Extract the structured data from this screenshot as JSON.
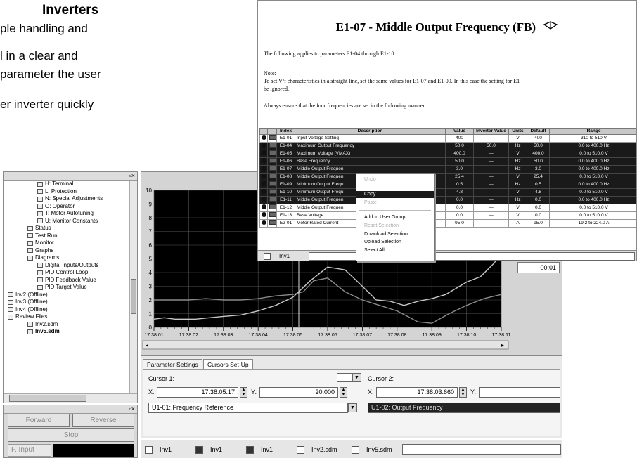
{
  "heading": {
    "title": "Inverters",
    "lines": [
      "ple handling and",
      "l in a clear and",
      "parameter the user",
      "er inverter quickly"
    ]
  },
  "tree": {
    "items": [
      {
        "label": "H: Terminal",
        "indent": 3
      },
      {
        "label": "L: Protection",
        "indent": 3
      },
      {
        "label": "N: Special Adjustments",
        "indent": 3
      },
      {
        "label": "O: Operator",
        "indent": 3
      },
      {
        "label": "T: Motor Autotuning",
        "indent": 3
      },
      {
        "label": "U: Monitor Constants",
        "indent": 3
      },
      {
        "label": "Status",
        "indent": 2
      },
      {
        "label": "Test Run",
        "indent": 2
      },
      {
        "label": "Monitor",
        "indent": 2
      },
      {
        "label": "Graphs",
        "indent": 2
      },
      {
        "label": "Diagrams",
        "indent": 2
      },
      {
        "label": "Digital Inputs/Outputs",
        "indent": 3
      },
      {
        "label": "PID Control Loop",
        "indent": 3
      },
      {
        "label": "PID Feedback Value",
        "indent": 3
      },
      {
        "label": "PID Target Value",
        "indent": 3
      },
      {
        "label": "Inv2 (Offline)",
        "indent": 0
      },
      {
        "label": "Inv3 (Offline)",
        "indent": 0
      },
      {
        "label": "Inv4 (Offline)",
        "indent": 0
      },
      {
        "label": "Review Files",
        "indent": 0
      },
      {
        "label": "Inv2.sdm",
        "indent": 2
      },
      {
        "label": "Inv5.sdm",
        "indent": 2
      }
    ]
  },
  "operator": {
    "forward": "Forward",
    "reverse": "Reverse",
    "stop": "Stop",
    "f_input": "F. Input"
  },
  "chart_data": {
    "type": "line",
    "y_ticks": [
      "0",
      "1",
      "2",
      "3",
      "4",
      "5",
      "6",
      "7",
      "8",
      "9",
      "10"
    ],
    "ylim": [
      0,
      10
    ],
    "x_ticks": [
      "17:38:01",
      "17:38:02",
      "17:38:03",
      "17:38:04",
      "17:38:05",
      "17:38:06",
      "17:38:07",
      "17:38:08",
      "17:38:09",
      "17:38:10",
      "17:38:11"
    ],
    "grid": true,
    "series": [
      {
        "x": [
          0,
          0.3,
          0.6,
          0.9,
          1.2,
          1.6,
          2.0,
          2.5,
          3.0,
          3.5,
          4.0,
          4.5,
          5.0,
          5.5,
          6.0,
          6.4,
          6.8,
          7.2,
          7.6,
          8.0,
          8.4,
          8.8,
          9.0,
          9.4,
          9.8,
          10.0
        ],
        "values": [
          0.6,
          0.7,
          0.6,
          0.6,
          0.6,
          0.7,
          0.8,
          0.9,
          1.2,
          1.6,
          2.2,
          3.4,
          4.4,
          4.2,
          3.0,
          2.0,
          1.9,
          1.6,
          1.9,
          2.1,
          2.4,
          3.0,
          3.3,
          3.7,
          4.7,
          5.5
        ]
      },
      {
        "x": [
          0,
          0.5,
          1.0,
          1.5,
          2.0,
          2.5,
          3.0,
          3.5,
          4.0,
          4.3,
          4.6,
          5.0,
          5.5,
          6.0,
          6.5,
          7.0,
          7.3,
          7.6,
          8.0,
          8.5,
          9.0,
          9.5,
          10.0
        ],
        "values": [
          2.0,
          2.0,
          2.0,
          2.1,
          2.0,
          2.0,
          2.1,
          2.3,
          2.4,
          2.6,
          3.4,
          3.6,
          2.6,
          2.0,
          1.6,
          1.2,
          0.8,
          0.4,
          0.3,
          1.0,
          1.6,
          2.1,
          2.4
        ]
      }
    ],
    "cursor_time": "17:38:05.17",
    "readout": "00:01"
  },
  "settings": {
    "tabs": [
      "Parameter Settings",
      "Cursors Set-Up"
    ],
    "cursor1_label": "Cursor 1:",
    "cursor2_label": "Cursor 2:",
    "x_label": "X:",
    "y_label": "Y:",
    "cursor1_x": "17:38:05.17",
    "cursor1_y": "20.000",
    "cursor2_x": "17:38:03.660",
    "cursor2_y": "",
    "cursor1_select": "U1-01: Frequency Reference",
    "cursor2_select": "U1-02: Output Frequency"
  },
  "statusbar": {
    "tabs": [
      "Inv1",
      "Inv1",
      "Inv1",
      "Inv2.sdm",
      "Inv5.sdm"
    ]
  },
  "help": {
    "title": "E1-07 - Middle Output Frequency (FB)",
    "p1": "The following applies to parameters E1-04 through E1-10.",
    "note": "Note:",
    "p2": "To set V/f characteristics in a straight line, set the same values for E1-07 and E1-09. In this case the setting for E1",
    "p2b": "be ignored.",
    "p3": "Always ensure that the four frequencies are set in the following manner:",
    "columns": [
      "Index",
      "Description",
      "Value",
      "Inverter Value",
      "Units",
      "Default",
      "Range"
    ],
    "rows": [
      {
        "index": "E1-01",
        "desc": "Input Voltage Setting",
        "value": "400",
        "inv": "—",
        "units": "V",
        "default": "400",
        "range": "310 to 510 V",
        "sel": false
      },
      {
        "index": "E1-04",
        "desc": "Maximum Output Frequency",
        "value": "50.0",
        "inv": "50.0",
        "units": "Hz",
        "default": "50.0",
        "range": "0.0 to 400.0 Hz",
        "sel": true
      },
      {
        "index": "E1-05",
        "desc": "Maximum Voltage (VMAX)",
        "value": "400.0",
        "inv": "—",
        "units": "V",
        "default": "400.0",
        "range": "0.0 to 510.0 V",
        "sel": true
      },
      {
        "index": "E1-06",
        "desc": "Base Frequency",
        "value": "50.0",
        "inv": "—",
        "units": "Hz",
        "default": "50.0",
        "range": "0.0 to 400.0 Hz",
        "sel": true
      },
      {
        "index": "E1-07",
        "desc": "Middle Output Frequen",
        "value": "3.0",
        "inv": "—",
        "units": "Hz",
        "default": "3.0",
        "range": "0.0 to 400.0 Hz",
        "sel": true
      },
      {
        "index": "E1-08",
        "desc": "Middle Output Frequen",
        "value": "25.4",
        "inv": "—",
        "units": "V",
        "default": "25.4",
        "range": "0.0 to 510.0 V",
        "sel": true
      },
      {
        "index": "E1-09",
        "desc": "Minimum Output Frequ",
        "value": "0.5",
        "inv": "—",
        "units": "Hz",
        "default": "0.5",
        "range": "0.0 to 400.0 Hz",
        "sel": true
      },
      {
        "index": "E1-10",
        "desc": "Minimum Output Frequ",
        "value": "4.8",
        "inv": "—",
        "units": "V",
        "default": "4.8",
        "range": "0.0 to 510.0 V",
        "sel": true
      },
      {
        "index": "E1-11",
        "desc": "Middle Output Frequen",
        "value": "0.0",
        "inv": "—",
        "units": "Hz",
        "default": "0.0",
        "range": "0.0 to 400.0 Hz",
        "sel": true
      },
      {
        "index": "E1-12",
        "desc": "Middle Output Frequen",
        "value": "0.0",
        "inv": "—",
        "units": "V",
        "default": "0.0",
        "range": "0.0 to 510.0 V",
        "sel": false
      },
      {
        "index": "E1-13",
        "desc": "Base Voltage",
        "value": "0.0",
        "inv": "—",
        "units": "V",
        "default": "0.0",
        "range": "0.0 to 510.0 V",
        "sel": false
      },
      {
        "index": "E2-01",
        "desc": "Motor Rated Current",
        "value": "95.0",
        "inv": "—",
        "units": "A",
        "default": "95.0",
        "range": "19.2 to 224.0 A",
        "sel": false
      }
    ],
    "bottom_tab": "Inv1"
  },
  "context_menu": {
    "items": [
      "Undo",
      "Copy",
      "Paste",
      "Add to User Group",
      "Reset Selection",
      "Download Selection",
      "Upload Selection",
      "Select All"
    ]
  }
}
